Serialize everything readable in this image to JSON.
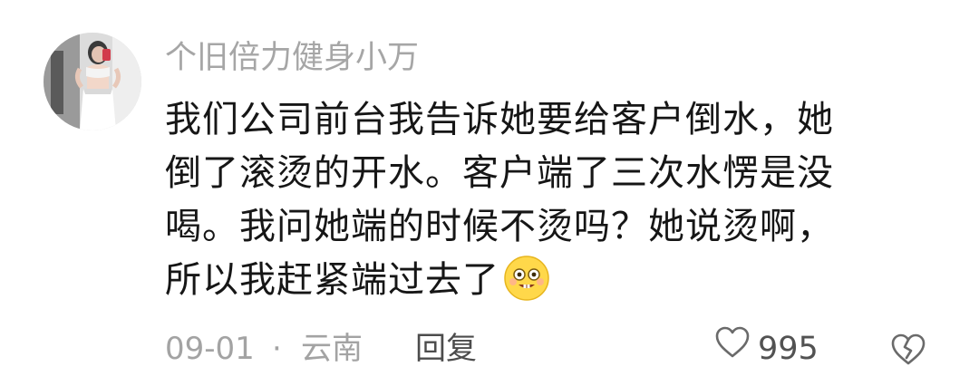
{
  "comment": {
    "username": "个旧倍力健身小万",
    "lines": [
      "我们公司前台我告诉她要给客户倒水，她",
      "倒了滚烫的开水。客户端了三次水愣是没",
      "喝。我问她端的时候不烫吗？她说烫啊，",
      "所以我赶紧端过去了"
    ],
    "date": "09-01",
    "separator": "·",
    "location": "云南",
    "reply_label": "回复",
    "like_count": "995"
  }
}
